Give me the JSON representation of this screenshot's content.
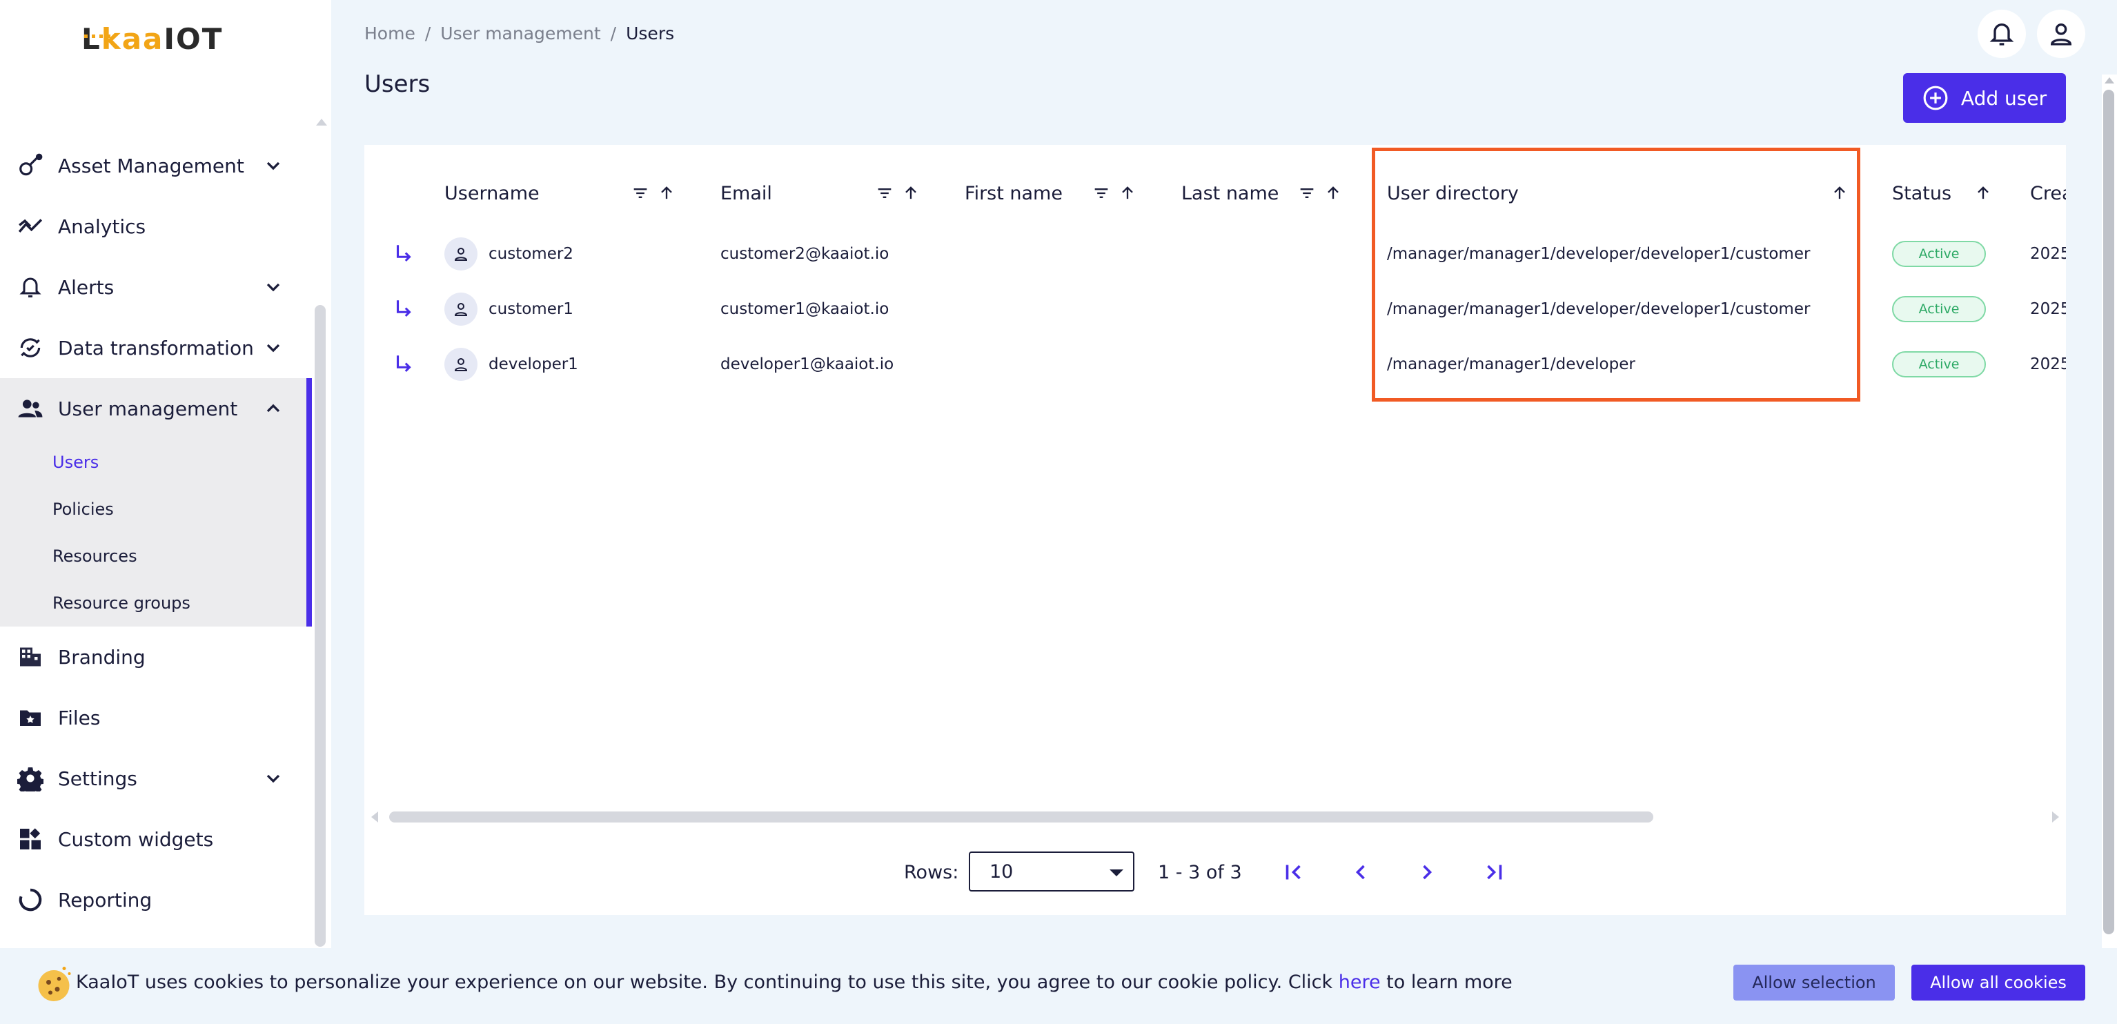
{
  "brand": {
    "logo_text_a": "L",
    "logo_text_b": "kaa",
    "logo_text_c": "IOT",
    "accent": "#4a2ee8",
    "logo_accent": "#f2a516"
  },
  "sidebar": {
    "items": [
      {
        "label": "Asset Management",
        "icon": "asset-icon",
        "has_chevron": true,
        "expanded": false
      },
      {
        "label": "Analytics",
        "icon": "analytics-icon",
        "has_chevron": false
      },
      {
        "label": "Alerts",
        "icon": "bell-icon",
        "has_chevron": true,
        "expanded": false
      },
      {
        "label": "Data transformation",
        "icon": "transform-icon",
        "has_chevron": true,
        "expanded": false
      },
      {
        "label": "User management",
        "icon": "users-icon",
        "has_chevron": true,
        "expanded": true
      },
      {
        "label": "Branding",
        "icon": "building-icon",
        "has_chevron": false
      },
      {
        "label": "Files",
        "icon": "folder-star-icon",
        "has_chevron": false
      },
      {
        "label": "Settings",
        "icon": "gear-icon",
        "has_chevron": true,
        "expanded": false
      },
      {
        "label": "Custom widgets",
        "icon": "widgets-icon",
        "has_chevron": false
      },
      {
        "label": "Reporting",
        "icon": "report-icon",
        "has_chevron": false
      }
    ],
    "user_management_sub": [
      {
        "label": "Users",
        "active": true
      },
      {
        "label": "Policies",
        "active": false
      },
      {
        "label": "Resources",
        "active": false
      },
      {
        "label": "Resource groups",
        "active": false
      }
    ]
  },
  "breadcrumb": {
    "home": "Home",
    "sep": "/",
    "section": "User management",
    "current": "Users"
  },
  "page": {
    "title": "Users",
    "add_button": "Add user"
  },
  "table": {
    "columns": {
      "username": "Username",
      "email": "Email",
      "first_name": "First name",
      "last_name": "Last name",
      "user_directory": "User directory",
      "status": "Status",
      "created": "Crea"
    },
    "rows": [
      {
        "username": "customer2",
        "email": "customer2@kaaiot.io",
        "first_name": "",
        "last_name": "",
        "user_directory": "/manager/manager1/developer/developer1/customer",
        "status": "Active",
        "created": "2025"
      },
      {
        "username": "customer1",
        "email": "customer1@kaaiot.io",
        "first_name": "",
        "last_name": "",
        "user_directory": "/manager/manager1/developer/developer1/customer",
        "status": "Active",
        "created": "2025"
      },
      {
        "username": "developer1",
        "email": "developer1@kaaiot.io",
        "first_name": "",
        "last_name": "",
        "user_directory": "/manager/manager1/developer",
        "status": "Active",
        "created": "2025"
      }
    ]
  },
  "pagination": {
    "rows_label": "Rows:",
    "rows_value": "10",
    "range": "1 - 3 of 3"
  },
  "cookie": {
    "text_before": "KaaIoT uses cookies to personalize your experience on our website. By continuing to use this site, you agree to our cookie policy. Click ",
    "link": "here",
    "text_after": " to learn more",
    "allow_selection": "Allow selection",
    "allow_all": "Allow all cookies"
  }
}
